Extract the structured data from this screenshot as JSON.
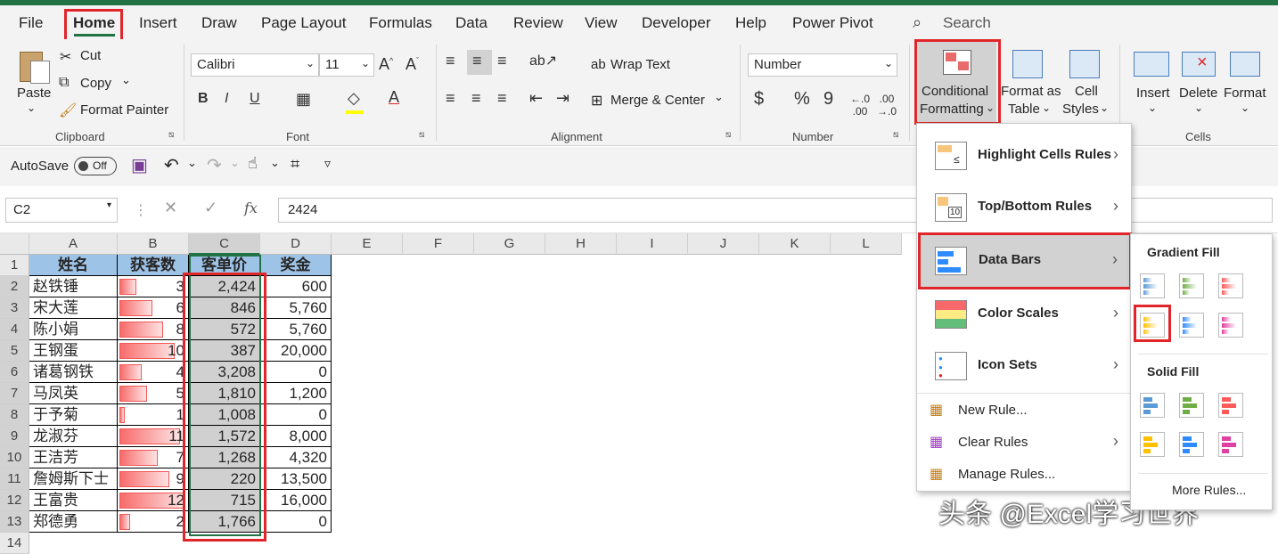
{
  "menu_tabs": [
    "File",
    "Home",
    "Insert",
    "Draw",
    "Page Layout",
    "Formulas",
    "Data",
    "Review",
    "View",
    "Developer",
    "Help",
    "Power Pivot"
  ],
  "search_label": "Search",
  "clipboard": {
    "paste": "Paste",
    "cut": "Cut",
    "copy": "Copy",
    "format_painter": "Format Painter",
    "group": "Clipboard"
  },
  "font": {
    "name": "Calibri",
    "size": "11",
    "group": "Font",
    "bold": "B",
    "italic": "I",
    "underline": "U"
  },
  "alignment": {
    "wrap": "Wrap Text",
    "merge": "Merge & Center",
    "group": "Alignment"
  },
  "number": {
    "format": "Number",
    "group": "Number",
    "currency": "$",
    "percent": "%",
    "comma": "9"
  },
  "styles": {
    "cf1": "Conditional",
    "cf2": "Formatting",
    "fat1": "Format as",
    "fat2": "Table",
    "cs1": "Cell",
    "cs2": "Styles"
  },
  "cells": {
    "insert": "Insert",
    "delete": "Delete",
    "format": "Format",
    "group": "Cells"
  },
  "qat": {
    "autosave": "AutoSave",
    "toggle": "Off"
  },
  "formula_bar": {
    "name_box": "C2",
    "fx": "fx",
    "value": "2424"
  },
  "columns": [
    "A",
    "B",
    "C",
    "D",
    "E",
    "F",
    "G",
    "H",
    "I",
    "J",
    "K",
    "L"
  ],
  "row_numbers": [
    "1",
    "2",
    "3",
    "4",
    "5",
    "6",
    "7",
    "8",
    "9",
    "10",
    "11",
    "12",
    "13",
    "14"
  ],
  "table": {
    "headers": [
      "姓名",
      "获客数",
      "客单价",
      "奖金"
    ],
    "rows": [
      {
        "name": "赵铁锤",
        "customers": "3",
        "price": "2,424",
        "bonus": "600",
        "bar": 0.25
      },
      {
        "name": "宋大莲",
        "customers": "6",
        "price": "846",
        "bonus": "5,760",
        "bar": 0.5
      },
      {
        "name": "陈小娟",
        "customers": "8",
        "price": "572",
        "bonus": "5,760",
        "bar": 0.667
      },
      {
        "name": "王钢蛋",
        "customers": "10",
        "price": "387",
        "bonus": "20,000",
        "bar": 0.833
      },
      {
        "name": "诸葛钢铁",
        "customers": "4",
        "price": "3,208",
        "bonus": "0",
        "bar": 0.333
      },
      {
        "name": "马凤英",
        "customers": "5",
        "price": "1,810",
        "bonus": "1,200",
        "bar": 0.417
      },
      {
        "name": "于予菊",
        "customers": "1",
        "price": "1,008",
        "bonus": "0",
        "bar": 0.083
      },
      {
        "name": "龙淑芬",
        "customers": "11",
        "price": "1,572",
        "bonus": "8,000",
        "bar": 0.917
      },
      {
        "name": "王洁芳",
        "customers": "7",
        "price": "1,268",
        "bonus": "4,320",
        "bar": 0.583
      },
      {
        "name": "詹姆斯下士",
        "customers": "9",
        "price": "220",
        "bonus": "13,500",
        "bar": 0.75
      },
      {
        "name": "王富贵",
        "customers": "12",
        "price": "715",
        "bonus": "16,000",
        "bar": 1.0
      },
      {
        "name": "郑德勇",
        "customers": "2",
        "price": "1,766",
        "bonus": "0",
        "bar": 0.167
      }
    ]
  },
  "cf_menu": {
    "highlight": "Highlight Cells Rules",
    "topbottom": "Top/Bottom Rules",
    "databars": "Data Bars",
    "colorscales": "Color Scales",
    "iconsets": "Icon Sets",
    "newrule": "New Rule...",
    "clearrules": "Clear Rules",
    "managerules": "Manage Rules..."
  },
  "databars_menu": {
    "gradient": "Gradient Fill",
    "solid": "Solid Fill",
    "more": "More Rules..."
  },
  "swatch_colors": [
    "#5b9bd5",
    "#70ad47",
    "#ff5a5a",
    "#ffc000",
    "#2e8bff",
    "#e040a0"
  ],
  "watermark": "头条 @Excel学习世界"
}
